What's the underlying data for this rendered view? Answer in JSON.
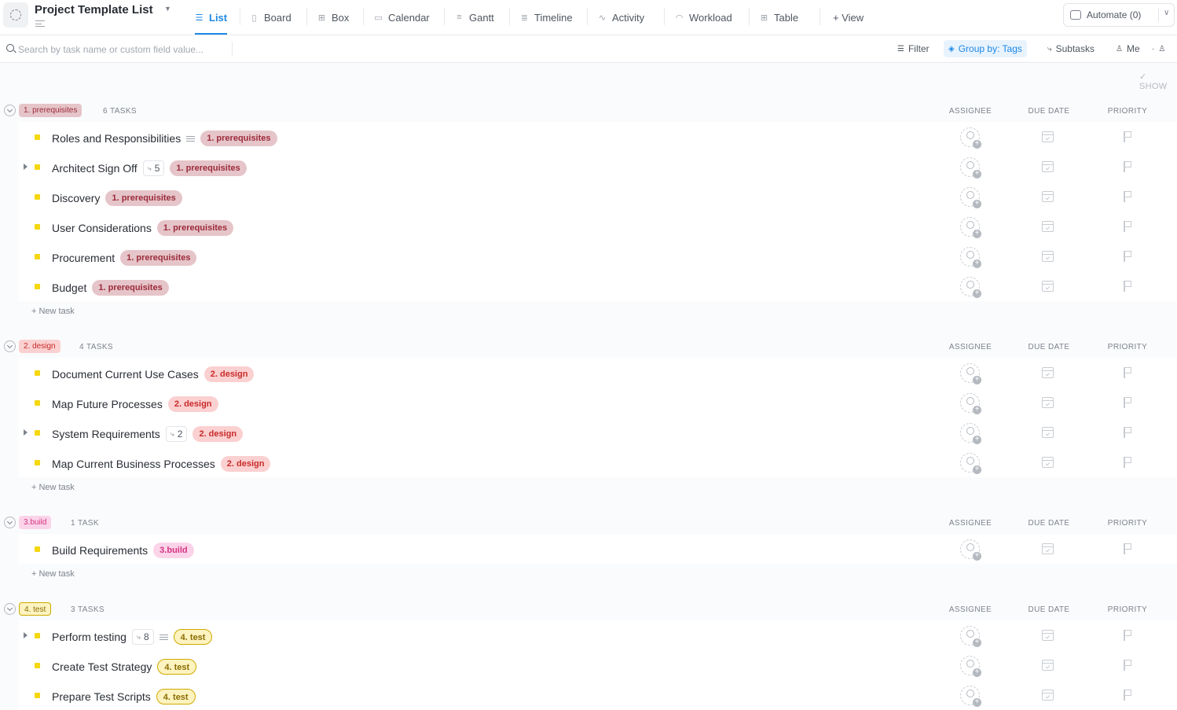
{
  "header": {
    "title": "Project Template List",
    "tabs": [
      {
        "label": "List",
        "icon": "list-icon"
      },
      {
        "label": "Board",
        "icon": "board-icon"
      },
      {
        "label": "Box",
        "icon": "box-icon"
      },
      {
        "label": "Calendar",
        "icon": "calendar-icon"
      },
      {
        "label": "Gantt",
        "icon": "gantt-icon"
      },
      {
        "label": "Timeline",
        "icon": "timeline-icon"
      },
      {
        "label": "Activity",
        "icon": "activity-icon"
      },
      {
        "label": "Workload",
        "icon": "workload-icon"
      },
      {
        "label": "Table",
        "icon": "table-icon"
      },
      {
        "label": "+ View",
        "icon": ""
      }
    ],
    "automate_label": "Automate (0)"
  },
  "toolbar": {
    "search_placeholder": "Search by task name or custom field value...",
    "filter_label": "Filter",
    "group_label": "Group by: Tags",
    "subtasks_label": "Subtasks",
    "me_label": "Me",
    "show_label": "SHOW"
  },
  "columns": {
    "assignee": "ASSIGNEE",
    "due": "DUE DATE",
    "priority": "PRIORITY"
  },
  "new_task_label": "+ New task",
  "groups": [
    {
      "tag": "1. prerequisites",
      "count": "6 TASKS",
      "tasks": [
        {
          "name": "Roles and Responsibilities",
          "tag": "1. prerequisites"
        },
        {
          "name": "Architect Sign Off",
          "subtasks": "5",
          "tag": "1. prerequisites"
        },
        {
          "name": "Discovery",
          "tag": "1. prerequisites"
        },
        {
          "name": "User Considerations",
          "tag": "1. prerequisites"
        },
        {
          "name": "Procurement",
          "tag": "1. prerequisites"
        },
        {
          "name": "Budget",
          "tag": "1. prerequisites"
        }
      ]
    },
    {
      "tag": "2. design",
      "count": "4 TASKS",
      "tasks": [
        {
          "name": "Document Current Use Cases",
          "tag": "2. design"
        },
        {
          "name": "Map Future Processes",
          "tag": "2. design"
        },
        {
          "name": "System Requirements",
          "subtasks": "2",
          "tag": "2. design"
        },
        {
          "name": "Map Current Business Processes",
          "tag": "2. design"
        }
      ]
    },
    {
      "tag": "3.build",
      "count": "1 TASK",
      "tasks": [
        {
          "name": "Build Requirements",
          "tag": "3.build"
        }
      ]
    },
    {
      "tag": "4. test",
      "count": "3 TASKS",
      "tasks": [
        {
          "name": "Perform testing",
          "subtasks": "8",
          "tag": "4. test"
        },
        {
          "name": "Create Test Strategy",
          "tag": "4. test"
        },
        {
          "name": "Prepare Test Scripts",
          "tag": "4. test"
        }
      ]
    }
  ]
}
